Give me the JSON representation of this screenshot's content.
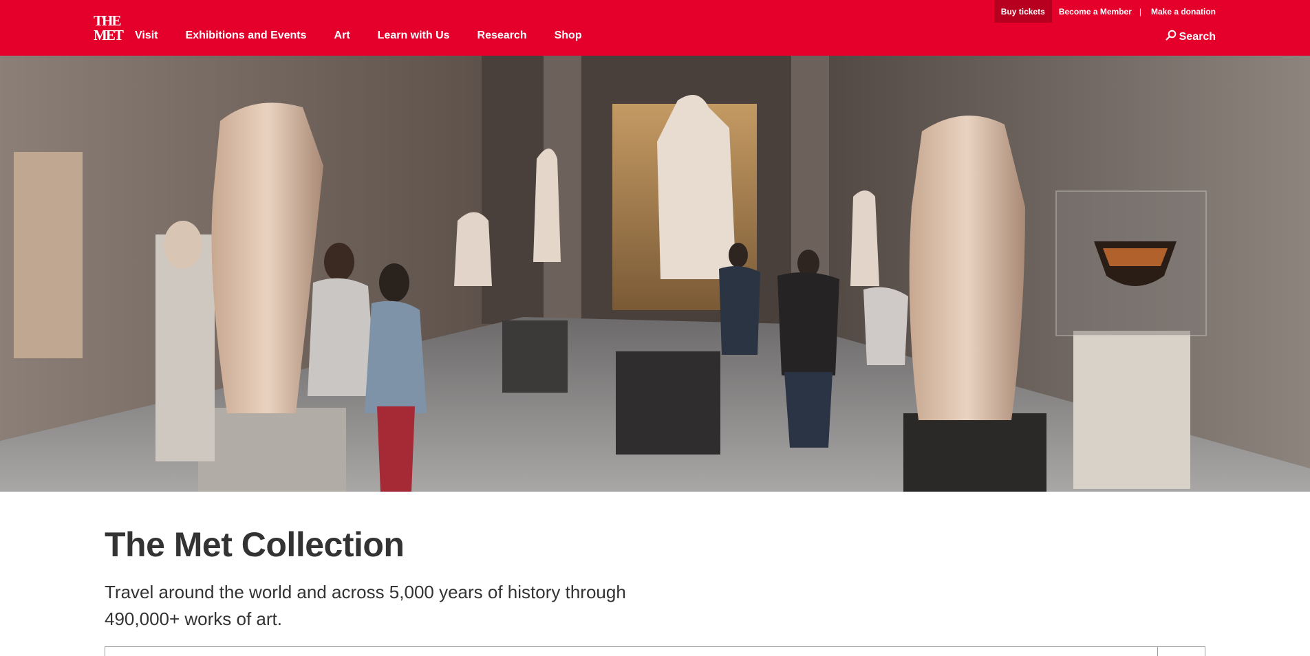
{
  "header": {
    "logo": {
      "line1": "THE",
      "line2": "MET"
    },
    "nav": [
      {
        "label": "Visit"
      },
      {
        "label": "Exhibitions and Events"
      },
      {
        "label": "Art"
      },
      {
        "label": "Learn with Us"
      },
      {
        "label": "Research"
      },
      {
        "label": "Shop"
      }
    ],
    "utility": {
      "buy_tickets": "Buy tickets",
      "become_member": "Become a Member",
      "separator": "|",
      "donate": "Make a donation"
    },
    "search_label": "Search"
  },
  "hero": {
    "image": "museum-gallery-sculptures"
  },
  "intro": {
    "title": "The Met Collection",
    "subtitle": "Travel around the world and across 5,000 years of history through 490,000+ works of art."
  },
  "search_box": {
    "placeholder": ""
  },
  "colors": {
    "brand_red": "#e4002b",
    "tickets_bg": "#b7001f",
    "text": "#333333"
  },
  "icons": {
    "search": "search-icon"
  }
}
